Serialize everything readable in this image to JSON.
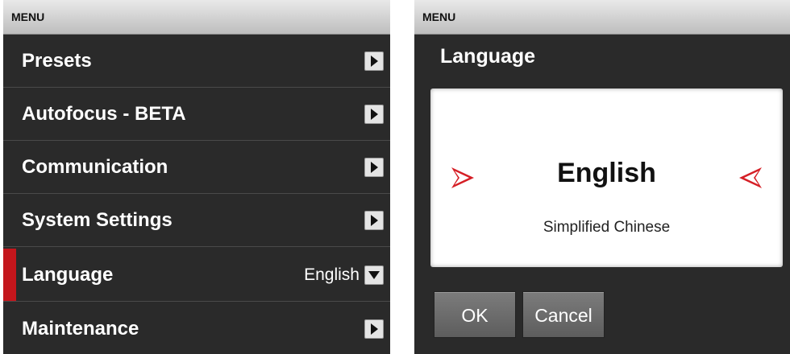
{
  "left": {
    "header": "MENU",
    "items": [
      {
        "label": "Presets",
        "value": "",
        "icon": "chevron-right-icon"
      },
      {
        "label": "Autofocus - BETA",
        "value": "",
        "icon": "chevron-right-icon"
      },
      {
        "label": "Communication",
        "value": "",
        "icon": "chevron-right-icon"
      },
      {
        "label": "System Settings",
        "value": "",
        "icon": "chevron-right-icon"
      },
      {
        "label": "Language",
        "value": "English",
        "icon": "chevron-down-icon"
      },
      {
        "label": "Maintenance",
        "value": "",
        "icon": "chevron-right-icon"
      }
    ]
  },
  "right": {
    "header": "MENU",
    "title": "Language",
    "selected_language": "English",
    "next_language": "Simplified Chinese",
    "ok_label": "OK",
    "cancel_label": "Cancel"
  },
  "colors": {
    "accent": "#c4161c",
    "panel_background": "#2a2a2a",
    "header_background": "#d3d3d3",
    "button_background": "#6c6c6c"
  }
}
